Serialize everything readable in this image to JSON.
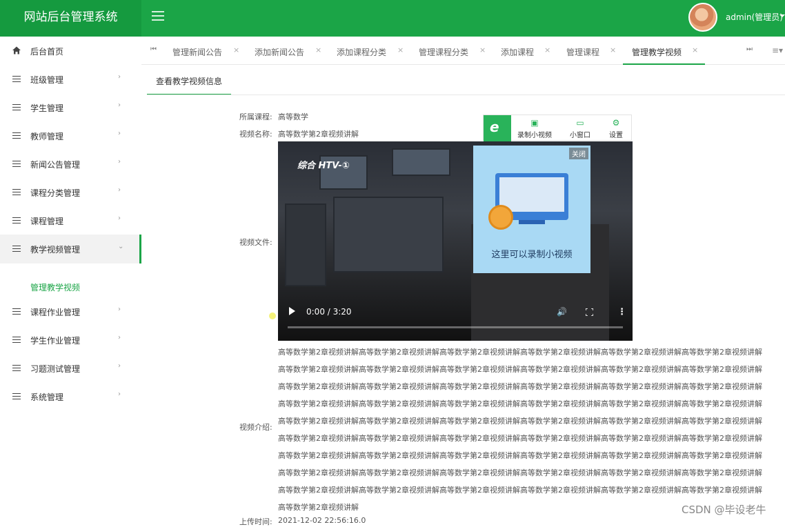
{
  "header": {
    "title": "网站后台管理系统",
    "user": "admin(管理员)"
  },
  "sidebar": {
    "items": [
      {
        "label": "后台首页"
      },
      {
        "label": "班级管理"
      },
      {
        "label": "学生管理"
      },
      {
        "label": "教师管理"
      },
      {
        "label": "新闻公告管理"
      },
      {
        "label": "课程分类管理"
      },
      {
        "label": "课程管理"
      },
      {
        "label": "教学视频管理"
      },
      {
        "label": "课程作业管理"
      },
      {
        "label": "学生作业管理"
      },
      {
        "label": "习题测试管理"
      },
      {
        "label": "系统管理"
      }
    ],
    "sub_item": "管理教学视频"
  },
  "tabs": [
    {
      "label": "管理新闻公告"
    },
    {
      "label": "添加新闻公告"
    },
    {
      "label": "添加课程分类"
    },
    {
      "label": "管理课程分类"
    },
    {
      "label": "添加课程"
    },
    {
      "label": "管理课程"
    },
    {
      "label": "管理教学视频"
    }
  ],
  "panel_tab": "查看教学视频信息",
  "form": {
    "course_label": "所属课程:",
    "course": "高等数学",
    "name_label": "视频名称:",
    "name": "高等数学第2章视频讲解",
    "file_label": "视频文件:",
    "desc_label": "视频介绍:",
    "upload_label": "上传时间:",
    "upload_time": "2021-12-02 22:56:16.0"
  },
  "video": {
    "station": "综合 HTV-①",
    "time": "0:00 / 3:20",
    "progress": 0.0
  },
  "recorder": {
    "buttons": [
      {
        "label": "录制小视频"
      },
      {
        "label": "小窗口"
      },
      {
        "label": "设置"
      }
    ],
    "popup_close": "关闭",
    "popup_text": "这里可以录制小视频"
  },
  "description_lines": [
    "高等数学第2章视频讲解高等数学第2章视频讲解高等数学第2章视频讲解高等数学第2章视频讲解高等数学第2章视频讲解高等数学第2章视频讲解",
    "高等数学第2章视频讲解高等数学第2章视频讲解高等数学第2章视频讲解高等数学第2章视频讲解高等数学第2章视频讲解高等数学第2章视频讲解",
    "高等数学第2章视频讲解高等数学第2章视频讲解高等数学第2章视频讲解高等数学第2章视频讲解高等数学第2章视频讲解高等数学第2章视频讲解",
    "高等数学第2章视频讲解高等数学第2章视频讲解高等数学第2章视频讲解高等数学第2章视频讲解高等数学第2章视频讲解高等数学第2章视频讲解",
    "高等数学第2章视频讲解高等数学第2章视频讲解高等数学第2章视频讲解高等数学第2章视频讲解高等数学第2章视频讲解高等数学第2章视频讲解",
    "高等数学第2章视频讲解高等数学第2章视频讲解高等数学第2章视频讲解高等数学第2章视频讲解高等数学第2章视频讲解高等数学第2章视频讲解",
    "高等数学第2章视频讲解高等数学第2章视频讲解高等数学第2章视频讲解高等数学第2章视频讲解高等数学第2章视频讲解高等数学第2章视频讲解",
    "高等数学第2章视频讲解高等数学第2章视频讲解高等数学第2章视频讲解高等数学第2章视频讲解高等数学第2章视频讲解高等数学第2章视频讲解",
    "高等数学第2章视频讲解高等数学第2章视频讲解高等数学第2章视频讲解高等数学第2章视频讲解高等数学第2章视频讲解高等数学第2章视频讲解",
    "高等数学第2章视频讲解"
  ],
  "watermark": "CSDN @毕设老牛",
  "colors": {
    "brand": "#1ba547",
    "sidebar_active_bg": "#f2f2f2"
  }
}
